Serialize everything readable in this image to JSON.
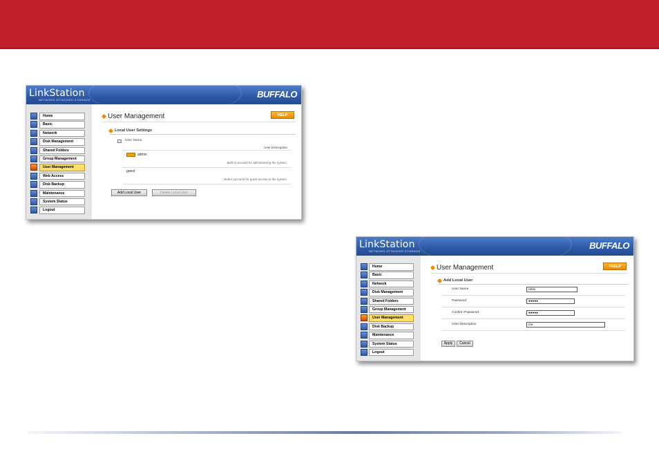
{
  "slide": {
    "accent_color": "#c0202c"
  },
  "screens": [
    {
      "banner": {
        "brand": "LinkStation",
        "tagline": "NETWORK ATTACHED STORAGE",
        "logo": "BUFFALO"
      },
      "nav": [
        {
          "label": "Home",
          "icon": "home-icon"
        },
        {
          "label": "Basic",
          "icon": "basic-icon"
        },
        {
          "label": "Network",
          "icon": "network-icon"
        },
        {
          "label": "Disk Management",
          "icon": "disk-icon"
        },
        {
          "label": "Shared Folders",
          "icon": "folder-icon"
        },
        {
          "label": "Group Management",
          "icon": "group-icon"
        },
        {
          "label": "User Management",
          "icon": "user-icon",
          "active": true
        },
        {
          "label": "Web Access",
          "icon": "web-icon"
        },
        {
          "label": "Disk Backup",
          "icon": "backup-icon"
        },
        {
          "label": "Maintenance",
          "icon": "maintenance-icon"
        },
        {
          "label": "System Status",
          "icon": "status-icon"
        },
        {
          "label": "Logout",
          "icon": "logout-icon"
        }
      ],
      "page_title": "User Management",
      "help_label": "HELP",
      "section_title": "Local User Settings",
      "table": {
        "col_name": "User Name",
        "col_desc": "User Description",
        "rows": [
          {
            "name": "admin",
            "desc": "Built-in account for administering the system."
          },
          {
            "name": "guest",
            "desc": "Built-in account for guest access to the system."
          }
        ]
      },
      "buttons": {
        "add": "Add Local User",
        "delete": "Delete Local User"
      }
    },
    {
      "banner": {
        "brand": "LinkStation",
        "tagline": "NETWORK ATTACHED STORAGE",
        "logo": "BUFFALO"
      },
      "nav": [
        {
          "label": "Home"
        },
        {
          "label": "Basic"
        },
        {
          "label": "Network"
        },
        {
          "label": "Disk Management"
        },
        {
          "label": "Shared Folders"
        },
        {
          "label": "Group Management"
        },
        {
          "label": "User Management",
          "active": true
        },
        {
          "label": "Disk Backup"
        },
        {
          "label": "Maintenance"
        },
        {
          "label": "System Status"
        },
        {
          "label": "Logout"
        }
      ],
      "page_title": "User Management",
      "help_label": "?HELP",
      "section_title": "Add Local User",
      "form": [
        {
          "label": "User Name",
          "value": "robin"
        },
        {
          "label": "Password",
          "value": "●●●●●"
        },
        {
          "label": "Confirm Password",
          "value": "●●●●●"
        },
        {
          "label": "User Description",
          "value": "me"
        }
      ],
      "buttons": {
        "apply": "Apply",
        "cancel": "Cancel"
      }
    }
  ]
}
